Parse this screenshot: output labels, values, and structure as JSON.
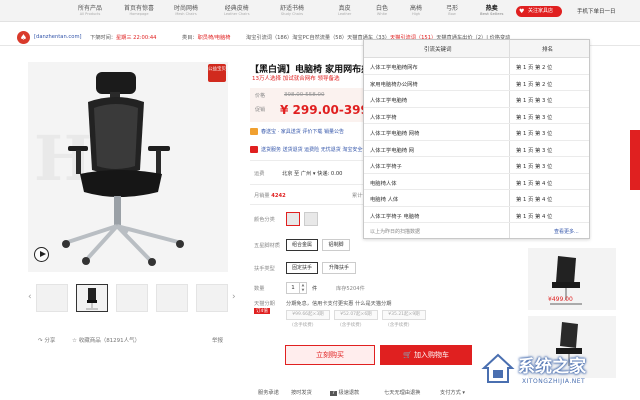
{
  "nav": {
    "items": [
      {
        "label": "所有产品",
        "sub": "All Products"
      },
      {
        "label": "首页有惊喜",
        "sub": "Homepage"
      },
      {
        "label": "时尚网椅",
        "sub": "Mesh Chairs"
      },
      {
        "label": "经典皮椅",
        "sub": "Leather Chairs"
      },
      {
        "label": "舒适书椅",
        "sub": "Study Chairs"
      },
      {
        "label": "真皮",
        "sub": "Leather"
      },
      {
        "label": "白色",
        "sub": "White"
      },
      {
        "label": "高椅",
        "sub": "High"
      },
      {
        "label": "弓形",
        "sub": "Bow"
      },
      {
        "label": "热卖",
        "sub": "Best Sellers"
      }
    ],
    "follow_label": "关注家具店",
    "phone_label": "手机下单日一日"
  },
  "shopbar": {
    "domain": "[danzhentan.com]",
    "countdown_label": "下架时间：",
    "countdown_value": "星期三 22:00:44",
    "category_label": "类目：",
    "category_value": "职员椅/电脑椅",
    "rank_text": "淘宝引流词（186）淘宝PC自然流量（58）天猫直通车（33）",
    "rank_red": "天猫引流词（151）",
    "rank_tail": "天猫直通车出价（2）| 价格变动"
  },
  "product": {
    "badge": "公益宝贝",
    "watermark": "H",
    "title": "【黑白调】电脑椅 家用网布办公",
    "subtitle": "13万人选择 加试就合网布 领导备选",
    "price_label": "价格",
    "old_price": "398.00-558.00",
    "promo_label": "促销",
    "new_price": "¥ 299.00-399",
    "promo1": "春送宝 · 家具送货  评价下载  销量公告",
    "promo2": "送货服务  送货退货  运费险  无忧退货  淘宝安全订单",
    "ship_label": "运费",
    "ship_value": "北京 至 广州 ▾  快递: 0.00",
    "sales_label": "月销量",
    "sales_value": "4242",
    "reviews_label": "累计评价",
    "color_label": "颜色分类",
    "five_label": "五星脚材质",
    "five_opts": [
      "组合金属",
      "铝制脚"
    ],
    "arm_label": "扶手类型",
    "arm_opts": [
      "固定扶手",
      "升降扶手"
    ],
    "qty_label": "数量",
    "qty_value": "1",
    "qty_unit": "件",
    "stock_text": "库存5204件",
    "pay_label": "天猫分期",
    "pay_tag": "订4值",
    "pay_note": "分期免息，信用卡支付更实惠 什么是天猫分期",
    "pay_opts": [
      "¥99.66起×3期",
      "¥52.07起×6期",
      "¥35.21起×9期"
    ],
    "pay_subs": [
      "(含手续费)",
      "(含手续费)",
      "(含手续费)"
    ],
    "buy_label": "立刻购买",
    "cart_label": "加入购物车",
    "share_label": "分享",
    "fav_label": "收藏商品（81291人气）",
    "report_label": "举报"
  },
  "keywords": {
    "col_kw": "引流关键词",
    "col_rank": "排名",
    "rows": [
      {
        "kw": "人体工学电脑椅网布",
        "rank": "第 1 页 第 2 位"
      },
      {
        "kw": "家用电脑椅办公网椅",
        "rank": "第 1 页 第 2 位"
      },
      {
        "kw": "人体工学电脑椅",
        "rank": "第 1 页 第 3 位"
      },
      {
        "kw": "人体工学椅",
        "rank": "第 1 页 第 3 位"
      },
      {
        "kw": "人体工学电脑椅 网椅",
        "rank": "第 1 页 第 3 位"
      },
      {
        "kw": "人体工学电脑椅 网",
        "rank": "第 1 页 第 3 位"
      },
      {
        "kw": "人体工学椅子",
        "rank": "第 1 页 第 3 位"
      },
      {
        "kw": "电脑椅人体",
        "rank": "第 1 页 第 4 位"
      },
      {
        "kw": "电脑椅 人体",
        "rank": "第 1 页 第 4 位"
      },
      {
        "kw": "人体工学椅子 电脑椅",
        "rank": "第 1 页 第 4 位"
      }
    ],
    "foot": "以上为昨日的扫描数据",
    "more": "查看更多..."
  },
  "bottom": {
    "links": [
      "服务承诺",
      "按时发货",
      "极速退款",
      "七天无理由退换",
      "支付方式 ▾"
    ],
    "badge": "7",
    "right_price": "¥499.00"
  },
  "watermark": {
    "text": "系统之家",
    "sub": "XITONGZHIJIA.NET"
  }
}
